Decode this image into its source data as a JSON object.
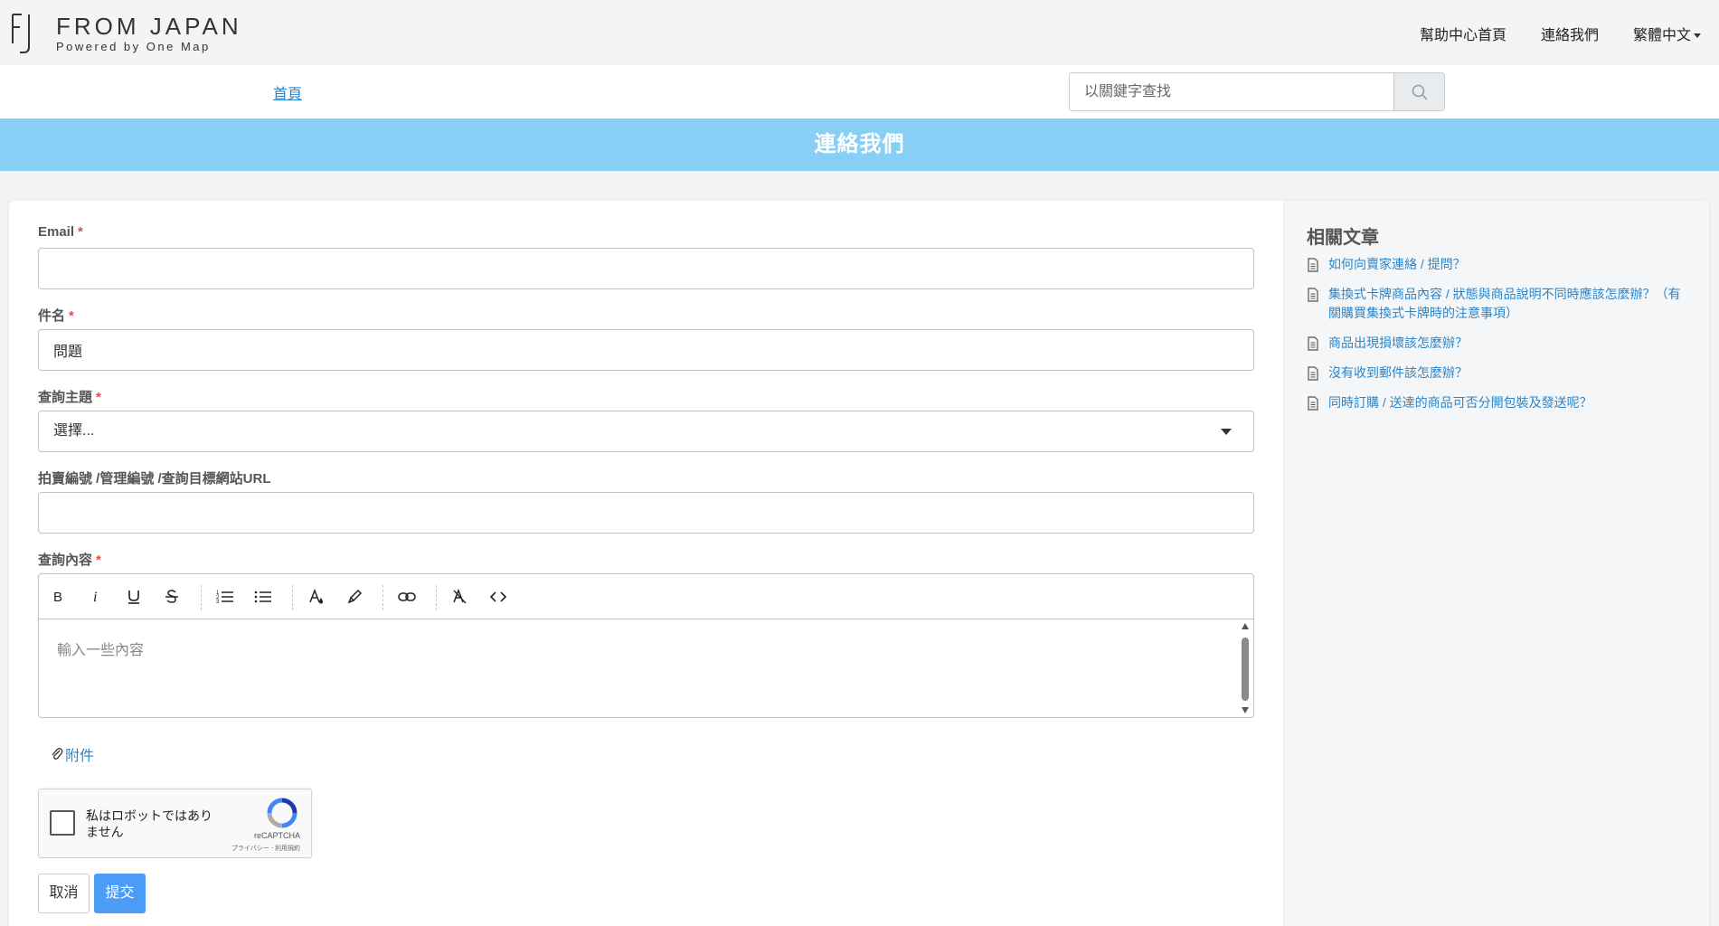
{
  "header": {
    "logo_title": "FROM JAPAN",
    "logo_subtitle": "Powered by One Map",
    "nav": {
      "help_home": "幫助中心首頁",
      "contact": "連絡我們",
      "language": "繁體中文"
    }
  },
  "subbar": {
    "breadcrumb_home": "首頁",
    "search_placeholder": "以關鍵字查找"
  },
  "banner": {
    "title": "連絡我們"
  },
  "form": {
    "required_mark": "*",
    "email_label": "Email",
    "email_value": "",
    "subject_label": "件名",
    "subject_value": "問題",
    "topic_label": "查詢主題",
    "topic_value": "選擇...",
    "url_label": "拍賣編號 /管理編號 /查詢目標網站URL",
    "url_value": "",
    "content_label": "查詢內容",
    "content_placeholder": "輸入一些內容",
    "attachment_label": "附件",
    "cancel_label": "取消",
    "submit_label": "提交"
  },
  "toolbar_icons": [
    "bold-icon",
    "italic-icon",
    "underline-icon",
    "strikethrough-icon",
    "ordered-list-icon",
    "unordered-list-icon",
    "text-color-icon",
    "highlight-icon",
    "link-icon",
    "clear-format-icon",
    "code-icon"
  ],
  "captcha": {
    "text": "私はロボットではありません",
    "brand": "reCAPTCHA",
    "links": "プライバシー - 利用規約"
  },
  "sidebar": {
    "title": "相關文章",
    "articles": [
      "如何向賣家連絡 / 提問？",
      "集換式卡牌商品內容 / 狀態與商品說明不同時應該怎麼辦？（有關購買集換式卡牌時的注意事項）",
      "商品出現損壞該怎麼辦？",
      "沒有收到郵件該怎麼辦？",
      "同時訂購 / 送達的商品可否分開包裝及發送呢？"
    ]
  },
  "colors": {
    "banner": "#87cff5",
    "link": "#2a86c9",
    "submit": "#4a9cf6",
    "required": "#d9534f"
  }
}
